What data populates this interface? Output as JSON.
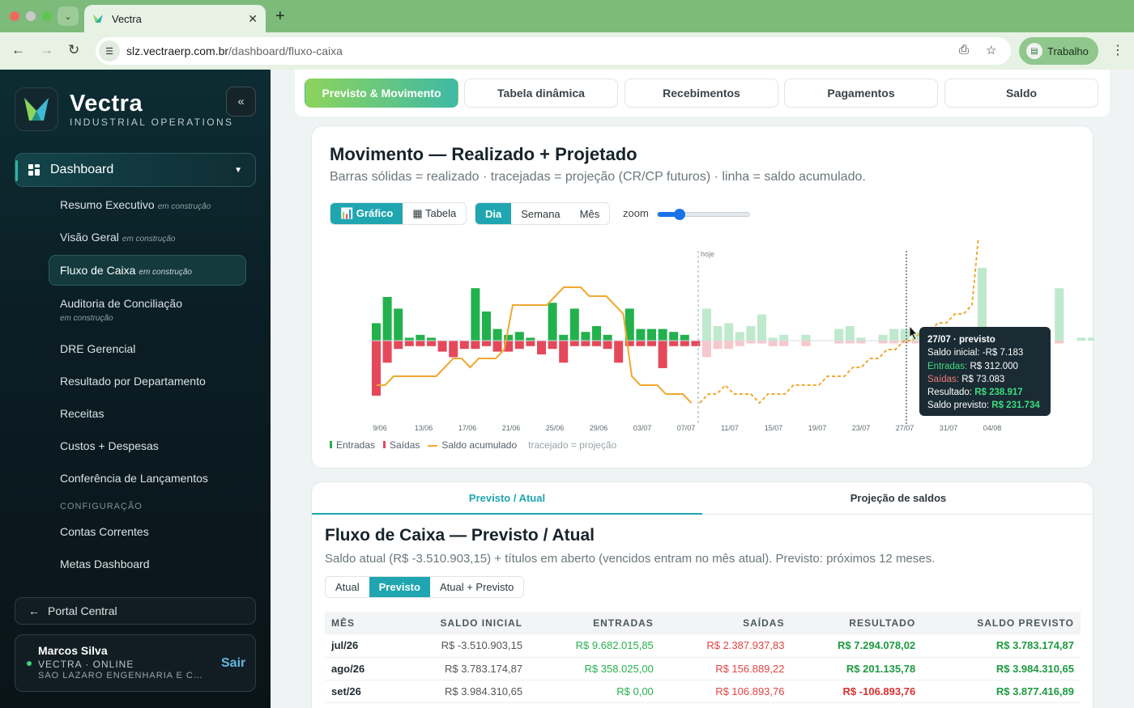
{
  "browser": {
    "tab_title": "Vectra",
    "url_host": "slz.vectraerp.com.br",
    "url_path": "/dashboard/fluxo-caixa",
    "profile": "Trabalho"
  },
  "sidebar": {
    "brand": "Vectra",
    "brand_sub": "INDUSTRIAL OPERATIONS",
    "dashboard": "Dashboard",
    "items": [
      {
        "label": "Resumo Executivo",
        "tag": "em construção"
      },
      {
        "label": "Visão Geral",
        "tag": "em construção"
      },
      {
        "label": "Fluxo de Caixa",
        "tag": "em construção"
      },
      {
        "label": "Auditoria de Conciliação",
        "tag": "em construção"
      },
      {
        "label": "DRE Gerencial",
        "tag": ""
      },
      {
        "label": "Resultado por Departamento",
        "tag": ""
      },
      {
        "label": "Receitas",
        "tag": ""
      },
      {
        "label": "Custos + Despesas",
        "tag": ""
      },
      {
        "label": "Conferência de Lançamentos",
        "tag": ""
      }
    ],
    "section": "CONFIGURAÇÃO",
    "config_items": [
      "Contas Correntes",
      "Metas Dashboard"
    ],
    "portal": "Portal Central",
    "user": {
      "name": "Marcos Silva",
      "status": "VECTRA · ONLINE",
      "company": "SAO LAZARO ENGENHARIA E CO...",
      "logout": "Sair"
    }
  },
  "page_tabs": [
    "Previsto & Movimento",
    "Tabela dinâmica",
    "Recebimentos",
    "Pagamentos",
    "Saldo"
  ],
  "movement": {
    "title": "Movimento — Realizado + Projetado",
    "subtitle": "Barras sólidas = realizado · tracejadas = projeção (CR/CP futuros) · linha = saldo acumulado.",
    "view_toggle": [
      "📊 Gráfico",
      "▦ Tabela"
    ],
    "period_toggle": [
      "Dia",
      "Semana",
      "Mês"
    ],
    "zoom_label": "zoom",
    "zoom_value": 0.25,
    "legend": [
      "Entradas",
      "Saídas",
      "Saldo acumulado",
      "tracejado = projeção"
    ],
    "colors": {
      "entradas": "#22b14c",
      "saidas": "#e5485a",
      "saldo": "#f0a830",
      "proj_in": "#bfe9cc",
      "proj_out": "#f6c7cc"
    },
    "tooltip": {
      "title": "27/07 · previsto",
      "saldo_inicial_label": "Saldo inicial:",
      "saldo_inicial": "-R$ 7.183",
      "entradas_label": "Entradas:",
      "entradas": "R$ 312.000",
      "saidas_label": "Saídas:",
      "saidas": "R$ 73.083",
      "resultado_label": "Resultado:",
      "resultado": "R$ 238.917",
      "saldo_previsto_label": "Saldo previsto:",
      "saldo_previsto": "R$ 231.734"
    }
  },
  "chart_data": {
    "type": "bar",
    "today_label": "hoje",
    "today_index": 30,
    "x_labels": [
      "9/06",
      "13/06",
      "17/06",
      "21/06",
      "25/06",
      "29/06",
      "03/07",
      "07/07",
      "11/07",
      "15/07",
      "19/07",
      "23/07",
      "27/07",
      "31/07",
      "04/08"
    ],
    "entradas": [
      6,
      15,
      11,
      1,
      2,
      1,
      0,
      0,
      0,
      18,
      10,
      4,
      2,
      3,
      1,
      0,
      13,
      2,
      11,
      3,
      5,
      2,
      0,
      11,
      4,
      4,
      4,
      3,
      2,
      0,
      11,
      5,
      6,
      3,
      5,
      9,
      1,
      2,
      0,
      2,
      0,
      0,
      4,
      5,
      1,
      0,
      2,
      4,
      4,
      3,
      1,
      1,
      1,
      2,
      1,
      25,
      0,
      1,
      2,
      1,
      1,
      0,
      18,
      0,
      1,
      1,
      1,
      2,
      0,
      2,
      0,
      0
    ],
    "saidas": [
      20,
      8,
      3,
      2,
      2,
      2,
      4,
      6,
      3,
      3,
      2,
      4,
      4,
      3,
      2,
      5,
      3,
      8,
      2,
      2,
      2,
      3,
      8,
      2,
      2,
      2,
      10,
      2,
      2,
      2,
      6,
      3,
      3,
      2,
      1,
      1,
      2,
      2,
      0,
      2,
      0,
      0,
      1,
      1,
      1,
      0,
      1,
      1,
      1,
      1,
      1,
      0,
      0,
      0,
      0,
      5,
      0,
      0,
      1,
      0,
      1,
      0,
      1,
      0,
      0,
      0,
      1,
      1,
      0,
      0,
      0,
      0
    ],
    "saldo_acumulado": [
      -5,
      -5,
      -4,
      -4,
      -4,
      -4,
      -4,
      -4,
      -3,
      -2,
      -2,
      -3,
      -2,
      -2,
      -2,
      -1,
      4,
      4,
      4,
      4,
      4,
      5,
      6,
      6,
      6,
      5,
      5,
      5,
      4,
      3,
      -4,
      -5,
      -5,
      -5,
      -6,
      -6,
      -6,
      -7,
      -7,
      -6,
      -6,
      -5,
      -6,
      -6,
      -6,
      -7,
      -6,
      -6,
      -6,
      -5,
      -5,
      -5,
      -5,
      -4,
      -4,
      -4,
      -3,
      -3,
      -2,
      -2,
      -1,
      -1,
      0,
      0,
      1,
      1,
      2,
      2,
      3,
      3,
      4,
      14,
      12,
      12,
      12,
      12,
      16,
      18,
      18,
      18,
      22,
      22
    ],
    "y_unit": "index"
  },
  "bottom_tabs": [
    "Previsto / Atual",
    "Projeção de saldos"
  ],
  "cashflow": {
    "title": "Fluxo de Caixa — Previsto / Atual",
    "subtitle": "Saldo atual (R$ -3.510.903,15) + títulos em aberto (vencidos entram no mês atual). Previsto: próximos 12 meses.",
    "modes": [
      "Atual",
      "Previsto",
      "Atual + Previsto"
    ],
    "columns": [
      "MÊS",
      "SALDO INICIAL",
      "ENTRADAS",
      "SAÍDAS",
      "RESULTADO",
      "SALDO PREVISTO"
    ],
    "rows": [
      [
        "jul/26",
        "R$ -3.510.903,15",
        "R$ 9.682.015,85",
        "R$ 2.387.937,83",
        "R$ 7.294.078,02",
        "R$ 3.783.174,87"
      ],
      [
        "ago/26",
        "R$ 3.783.174,87",
        "R$ 358.025,00",
        "R$ 156.889,22",
        "R$ 201.135,78",
        "R$ 3.984.310,65"
      ],
      [
        "set/26",
        "R$ 3.984.310,65",
        "R$ 0,00",
        "R$ 106.893,76",
        "R$ -106.893,76",
        "R$ 3.877.416,89"
      ]
    ]
  }
}
